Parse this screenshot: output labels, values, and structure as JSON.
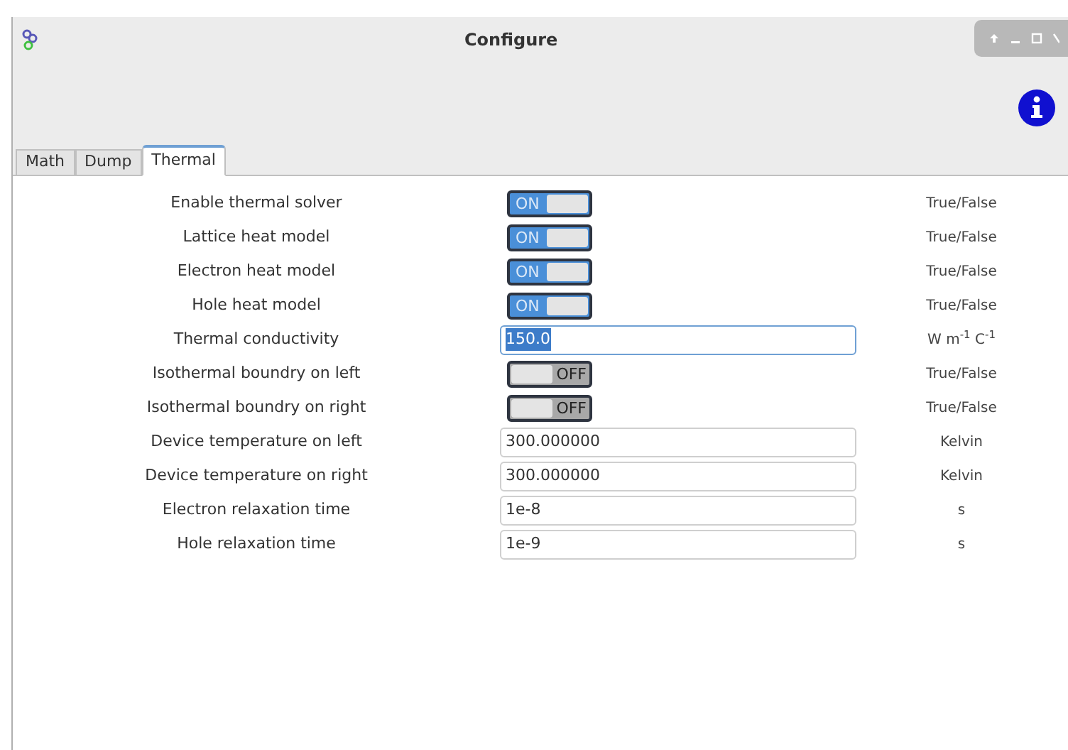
{
  "window": {
    "title": "Configure"
  },
  "tabs": [
    {
      "label": "Math",
      "selected": false
    },
    {
      "label": "Dump",
      "selected": false
    },
    {
      "label": "Thermal",
      "selected": true
    }
  ],
  "rows": [
    {
      "label": "Enable thermal solver",
      "kind": "toggle",
      "on": true,
      "text": "ON",
      "unit": "True/False"
    },
    {
      "label": "Lattice heat model",
      "kind": "toggle",
      "on": true,
      "text": "ON",
      "unit": "True/False"
    },
    {
      "label": "Electron heat model",
      "kind": "toggle",
      "on": true,
      "text": "ON",
      "unit": "True/False"
    },
    {
      "label": "Hole heat model",
      "kind": "toggle",
      "on": true,
      "text": "ON",
      "unit": "True/False"
    },
    {
      "label": "Thermal conductivity",
      "kind": "field",
      "value": "150.0",
      "focused": true,
      "unit": "W m$^{-1}$ C$^{-1}$"
    },
    {
      "label": "Isothermal boundry on left",
      "kind": "toggle",
      "on": false,
      "text": "OFF",
      "unit": "True/False"
    },
    {
      "label": "Isothermal boundry on right",
      "kind": "toggle",
      "on": false,
      "text": "OFF",
      "unit": "True/False"
    },
    {
      "label": "Device temperature on left",
      "kind": "field",
      "value": "300.000000",
      "focused": false,
      "unit": "Kelvin"
    },
    {
      "label": "Device temperature on right",
      "kind": "field",
      "value": "300.000000",
      "focused": false,
      "unit": "Kelvin"
    },
    {
      "label": "Electron relaxation time",
      "kind": "field",
      "value": "1e-8",
      "focused": false,
      "unit": "s"
    },
    {
      "label": "Hole relaxation time",
      "kind": "field",
      "value": "1e-9",
      "focused": false,
      "unit": "s"
    }
  ]
}
